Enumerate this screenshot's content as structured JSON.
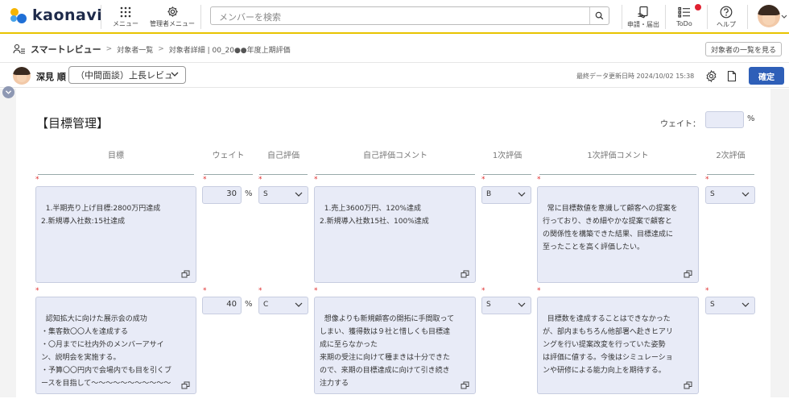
{
  "header": {
    "logo_text": "kaonavi",
    "menu_label": "メニュー",
    "admin_menu_label": "管理者メニュー",
    "search_placeholder": "メンバーを検索",
    "apply_label": "申請・届出",
    "todo_label": "ToDo",
    "help_label": "ヘルプ",
    "todo_badge_color": "#e02030",
    "accent_line_color": "#e8c400"
  },
  "breadcrumb": {
    "app": "スマートレビュー",
    "items": [
      "対象者一覧",
      "対象者詳細 | 00_20●●年度上期評価"
    ],
    "back_button": "対象者の一覧を見る"
  },
  "subject": {
    "name": "深見 順",
    "phase": "（中間面談）上長レビュ",
    "last_update": "最終データ更新日時 2024/10/02 15:38",
    "confirm_button": "確定",
    "confirm_color": "#2e5fb8"
  },
  "section": {
    "title": "【目標管理】",
    "weight_label": "ウェイト：",
    "weight_value": "",
    "weight_unit": "%"
  },
  "columns": [
    "目標",
    "ウェイト",
    "自己評価",
    "自己評価コメント",
    "1次評価",
    "1次評価コメント",
    "2次評価"
  ],
  "required_mark": "*",
  "rows": [
    {
      "goal": "1.半期売り上げ目標:2800万円達成\n2.新規導入社数:15社達成",
      "weight": "30",
      "weight_unit": "%",
      "self_eval": "S",
      "self_comment": "1.売上3600万円、120%達成\n2.新規導入社数15社、100%達成",
      "first_eval": "B",
      "first_comment": "常に目標数値を意識して顧客への提案を\n行っており、きめ細やかな提案で顧客と\nの関係性を構築できた結果、目標達成に\n至ったことを高く評価したい。",
      "second_eval": "S"
    },
    {
      "goal": "認知拡大に向けた展示会の成功\n・集客数〇〇人を達成する\n・〇月までに社内外のメンバーアサイ\nン、説明会を実施する。\n・予算〇〇円内で会場内でも目を引くブ\nースを目指して〜〜〜〜〜〜〜〜〜〜〜",
      "weight": "40",
      "weight_unit": "%",
      "self_eval": "C",
      "self_comment": "想像よりも新規顧客の開拓に手間取って\nしまい、獲得数は９社と惜しくも目標達\n成に至らなかった\n来期の受注に向けて種まきは十分できた\nので、来期の目標達成に向けて引き続き\n注力する",
      "first_eval": "S",
      "first_comment": "目標数を達成することはできなかった\nが、部内まもちろん他部署へ赴きヒアリ\nングを行い提案改変を行っていた姿勢\nは評価に値する。今後はシミュレーショ\nンや研修による能力向上を期待する。",
      "second_eval": "S"
    }
  ]
}
